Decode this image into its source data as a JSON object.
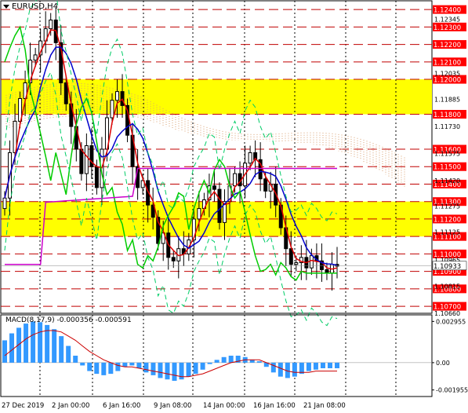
{
  "window": {
    "title": "EURUSD,H4"
  },
  "colors": {
    "background": "#ffffff",
    "grid": "#000000",
    "level_line": "#c00000",
    "zone_fill": "#ffff00",
    "price_tag_bg": "#ff0000",
    "price_tag_text": "#ffffff",
    "candle": "#000000",
    "kijun": "#0000cc",
    "tenkan": "#dd0000",
    "chikou": "#00cc00",
    "senkou_b": "#cc00cc",
    "bands": "#00cc66",
    "cloud_hatch": "#d9a070",
    "macd_hist": "#3399ff",
    "macd_signal": "#cc0000"
  },
  "price_axis": {
    "highlighted_levels": [
      "1.12400",
      "1.12300",
      "1.12200",
      "1.12100",
      "1.12000",
      "1.11800",
      "1.11600",
      "1.11500",
      "1.11400",
      "1.11300",
      "1.11200",
      "1.11100",
      "1.11000",
      "1.10900",
      "1.10800",
      "1.10700"
    ],
    "plain_labels": [
      "1.12345",
      "1.12035",
      "1.11885",
      "1.11730",
      "1.11575",
      "1.11420",
      "1.11275",
      "1.11125",
      "1.10965",
      "1.10815",
      "1.10660"
    ],
    "current_price": "1.10933"
  },
  "time_axis": {
    "labels": [
      "27 Dec 2019",
      "2 Jan 00:00",
      "6 Jan 16:00",
      "9 Jan 08:00",
      "14 Jan 00:00",
      "16 Jan 16:00",
      "21 Jan 08:00"
    ]
  },
  "macd": {
    "label": "MACD(8,17,9) -0.000356 -0.000591",
    "axis_labels": [
      "0.002955",
      "0.00",
      "-0.001955"
    ]
  },
  "chart_data": {
    "type": "candlestick",
    "symbol": "EURUSD",
    "timeframe": "H4",
    "ylim": [
      1.1066,
      1.1245
    ],
    "support_resistance_levels": [
      1.124,
      1.123,
      1.122,
      1.121,
      1.12,
      1.118,
      1.116,
      1.115,
      1.114,
      1.113,
      1.112,
      1.111,
      1.11,
      1.109,
      1.108,
      1.107
    ],
    "highlight_zones": [
      [
        1.118,
        1.12
      ],
      [
        1.111,
        1.113
      ]
    ],
    "close_series": [
      1.1132,
      1.1158,
      1.1176,
      1.1189,
      1.1198,
      1.1211,
      1.1214,
      1.1222,
      1.1229,
      1.1234,
      1.1221,
      1.1198,
      1.1186,
      1.1173,
      1.116,
      1.1146,
      1.1162,
      1.115,
      1.1138,
      1.116,
      1.1178,
      1.1188,
      1.1193,
      1.1185,
      1.1168,
      1.115,
      1.1138,
      1.1142,
      1.1128,
      1.1121,
      1.1106,
      1.1112,
      1.1098,
      1.1096,
      1.1103,
      1.11,
      1.1108,
      1.112,
      1.1126,
      1.1131,
      1.1139,
      1.1137,
      1.1118,
      1.113,
      1.1139,
      1.1146,
      1.1139,
      1.1152,
      1.1158,
      1.1154,
      1.1143,
      1.1136,
      1.114,
      1.1128,
      1.1115,
      1.1103,
      1.1094,
      1.1095,
      1.1098,
      1.1092,
      1.1099,
      1.1096,
      1.1091,
      1.1089,
      1.1094,
      1.1093
    ],
    "macd_hist": [
      0.0016,
      0.0021,
      0.0025,
      0.0028,
      0.00295,
      0.0029,
      0.0027,
      0.0024,
      0.0019,
      0.0012,
      0.0005,
      -0.0002,
      -0.0006,
      -0.0008,
      -0.0009,
      -0.0008,
      -0.0006,
      -0.0003,
      -0.0002,
      -0.0004,
      -0.0007,
      -0.0009,
      -0.0011,
      -0.0012,
      -0.0013,
      -0.0012,
      -0.001,
      -0.0008,
      -0.0005,
      -0.0001,
      0.0002,
      0.0004,
      0.0005,
      0.0005,
      0.0004,
      0.0002,
      0.0001,
      -0.0003,
      -0.0007,
      -0.001,
      -0.0011,
      -0.001,
      -0.0008,
      -0.0006,
      -0.0005,
      -0.0004,
      -0.0004,
      -0.0004
    ],
    "macd_signal": [
      0.0005,
      0.0009,
      0.0013,
      0.0017,
      0.002,
      0.0022,
      0.0023,
      0.0023,
      0.0022,
      0.0019,
      0.0016,
      0.0012,
      0.0008,
      0.0005,
      0.0002,
      0.0,
      -0.0002,
      -0.0003,
      -0.0003,
      -0.0004,
      -0.0005,
      -0.0006,
      -0.0007,
      -0.0008,
      -0.0009,
      -0.001,
      -0.001,
      -0.0009,
      -0.0008,
      -0.0006,
      -0.0004,
      -0.0002,
      0.0,
      0.0001,
      0.0002,
      0.0002,
      0.0002,
      0.0,
      -0.0002,
      -0.0004,
      -0.0006,
      -0.0007,
      -0.0007,
      -0.0007,
      -0.0006,
      -0.0006,
      -0.0006,
      -0.0006
    ]
  }
}
